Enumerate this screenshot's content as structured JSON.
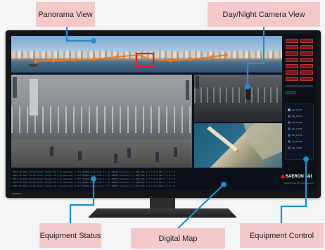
{
  "callouts": {
    "panorama_view": "Panorama View",
    "day_night_camera_view": "Day/Night Camera View",
    "equipment_status": "Equipment Status",
    "digital_map": "Digital Map",
    "equipment_control": "Equipment Control"
  },
  "logo": {
    "name": "SAERON S&I",
    "sub": "SAERON S&I  All rights reserved"
  },
  "monitor_brand": "SAERON",
  "status_rows": [
    "0015 TB 0001 01:00 Radar Target ID 1 N  Latitude: 1 037.00000 Longitude 1 1 37.00000 Distance 1 5 000   VEL 1 1 5 0.0 HDG 1 1 0.1 0",
    "0016 TB 0001 01:00 Radar Target ID 1 N  Latitude: 1 037.00000 Longitude 1 1 37.00000 Distance 1 5 000   VEL 1 1 5 0.0 HDG 1 1 0.1 0",
    "0017 TB 0001 01:00 Radar Target ID 1 N  Latitude: 1 037.00000 Longitude 1 1 37.00000 Distance 1 5 000   VEL 1 1 5 0.0 HDG 1 1 0.1 0",
    "0018 TB 0001 01:00 Radar Target ID 1 N  Latitude: 1 037.00000 Longitude 1 1 37.00000 Distance 1 5 000   VEL 1 1 5 0.0 HDG 1 1 0.1 0",
    "0019 TB 0001 01:00 Radar Target ID 1 N  Latitude: 1 037.00000 Longitude 1 1 37.00000 Distance 1 5 000   VEL 1 1 5 0.0 HDG 1 1 0.1 0"
  ],
  "equipment_list": [
    "CH_1 PTZ",
    "CH_2 PTZ",
    "CH_3 PTZ",
    "CH_4 PTZ",
    "CH_5 PTZ",
    "CH_6 PTZ",
    "CH_7 PTZ"
  ],
  "colors": {
    "accent": "#f07c1c",
    "leader": "#1f8fcf",
    "callout_bg": "#f3c9c9",
    "selection": "#e2231a",
    "control_button": "#7a1a1a"
  }
}
